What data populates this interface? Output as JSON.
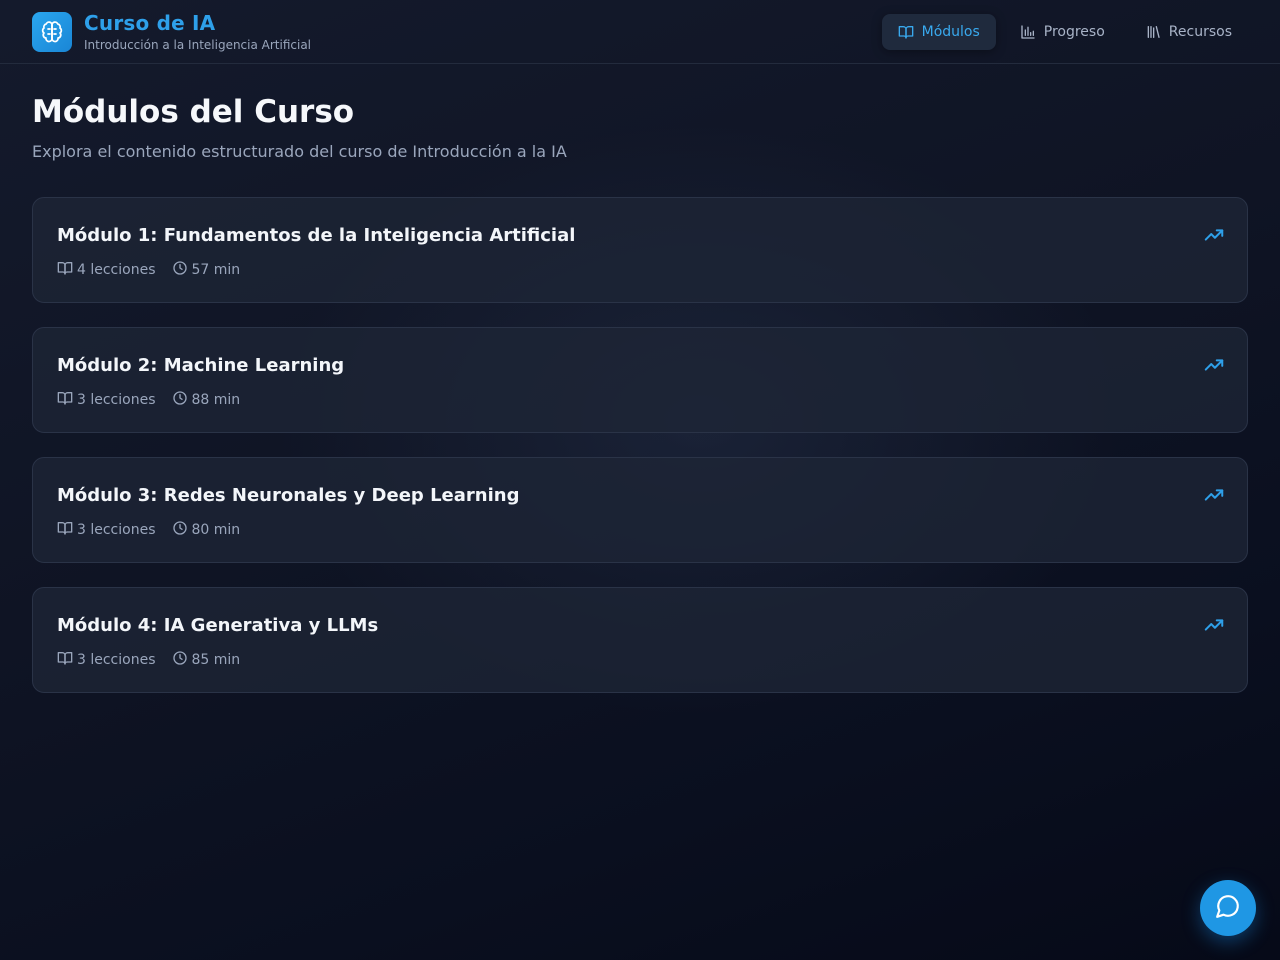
{
  "header": {
    "title": "Curso de IA",
    "subtitle": "Introducción a la Inteligencia Artificial",
    "logo_icon": "brain-icon",
    "nav": [
      {
        "label": "Módulos",
        "icon": "book-open-icon",
        "active": true
      },
      {
        "label": "Progreso",
        "icon": "bar-chart-icon",
        "active": false
      },
      {
        "label": "Recursos",
        "icon": "library-icon",
        "active": false
      }
    ]
  },
  "main": {
    "title": "Módulos del Curso",
    "subtitle": "Explora el contenido estructurado del curso de Introducción a la IA",
    "modules": [
      {
        "title": "Módulo 1: Fundamentos de la Inteligencia Artificial",
        "lessons": "4 lecciones",
        "duration": "57 min"
      },
      {
        "title": "Módulo 2: Machine Learning",
        "lessons": "3 lecciones",
        "duration": "88 min"
      },
      {
        "title": "Módulo 3: Redes Neuronales y Deep Learning",
        "lessons": "3 lecciones",
        "duration": "80 min"
      },
      {
        "title": "Módulo 4: IA Generativa y LLMs",
        "lessons": "3 lecciones",
        "duration": "85 min"
      }
    ]
  },
  "chat": {
    "icon": "message-circle-icon"
  },
  "colors": {
    "accent": "#2ea0ea",
    "background": "#0f1424",
    "card": "#1e2536"
  }
}
